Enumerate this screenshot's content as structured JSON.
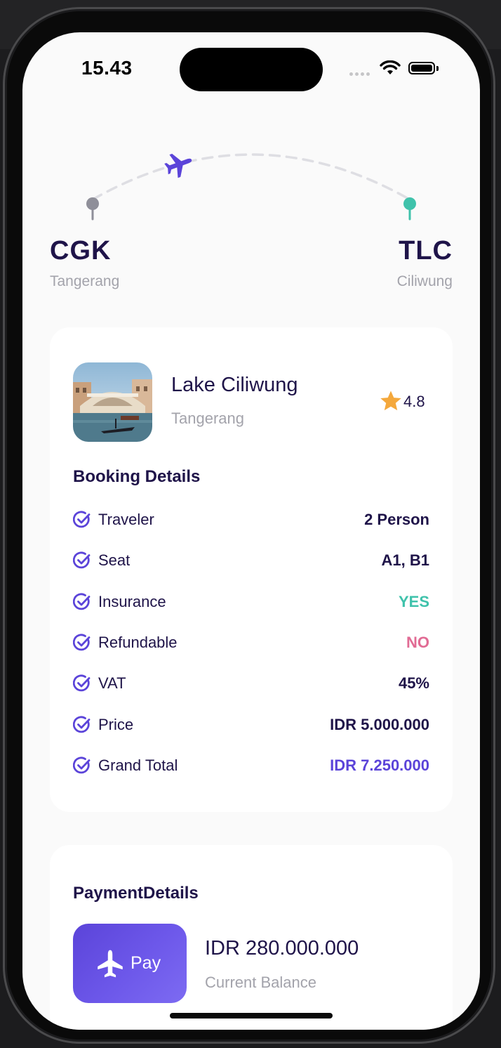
{
  "status_bar": {
    "time": "15.43"
  },
  "route": {
    "origin": {
      "code": "CGK",
      "city": "Tangerang"
    },
    "destination": {
      "code": "TLC",
      "city": "Ciliwung"
    }
  },
  "destination_card": {
    "name": "Lake Ciliwung",
    "city": "Tangerang",
    "rating": "4.8"
  },
  "booking": {
    "title": "Booking Details",
    "rows": [
      {
        "label": "Traveler",
        "value": "2 Person",
        "color": "#1f1449"
      },
      {
        "label": "Seat",
        "value": "A1, B1",
        "color": "#1f1449"
      },
      {
        "label": "Insurance",
        "value": "YES",
        "color": "#3fc2ab"
      },
      {
        "label": "Refundable",
        "value": "NO",
        "color": "#e16b94"
      },
      {
        "label": "VAT",
        "value": "45%",
        "color": "#1f1449"
      },
      {
        "label": "Price",
        "value": "IDR 5.000.000",
        "color": "#1f1449"
      },
      {
        "label": "Grand Total",
        "value": "IDR 7.250.000",
        "color": "#5b44d9"
      }
    ]
  },
  "payment": {
    "title": "PaymentDetails",
    "button_label": "Pay",
    "balance": "IDR 280.000.000",
    "balance_label": "Current Balance"
  },
  "colors": {
    "primary": "#5b44d9",
    "text": "#1f1449",
    "muted": "#a3a3ab",
    "success": "#3fc2ab",
    "danger": "#e16b94",
    "star": "#f4a83c"
  }
}
